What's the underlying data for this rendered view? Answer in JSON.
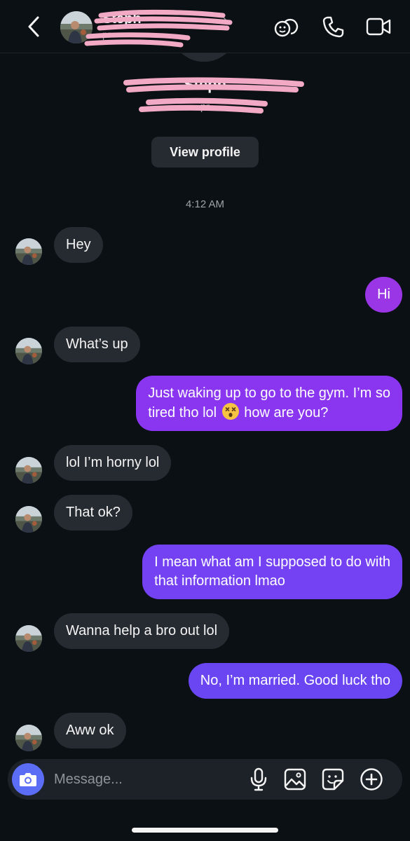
{
  "header": {
    "contact_name": "Steph",
    "contact_sub": "pr",
    "back_icon": "chevron-left-icon",
    "icons": [
      "stickers-icon",
      "phone-icon",
      "video-camera-icon"
    ]
  },
  "profile": {
    "name": "Steph",
    "handle": "pr",
    "view_profile_label": "View profile"
  },
  "thread": {
    "timestamp": "4:12 AM",
    "messages": [
      {
        "from": "them",
        "text": "Hey"
      },
      {
        "from": "me",
        "text": "Hi"
      },
      {
        "from": "them",
        "text": "What’s up"
      },
      {
        "from": "me",
        "line1": "Just waking up to go to the gym. I’m so",
        "line2_before": "tired tho lol",
        "emoji": "dizzy-face-emoji",
        "line2_after": "how are you?"
      },
      {
        "from": "them",
        "text": "lol I’m horny lol"
      },
      {
        "from": "them",
        "text": "That ok?"
      },
      {
        "from": "me",
        "line1": "I mean what am I supposed to do with",
        "line2": "that information lmao"
      },
      {
        "from": "them",
        "text": "Wanna help a bro out lol"
      },
      {
        "from": "me",
        "text": "No, I’m married. Good luck tho"
      },
      {
        "from": "them",
        "text": "Aww ok"
      }
    ]
  },
  "composer": {
    "placeholder": "Message...",
    "icons": [
      "camera-icon",
      "microphone-icon",
      "gallery-icon",
      "sticker-icon",
      "plus-icon"
    ]
  },
  "colors": {
    "background": "#0b1014",
    "incoming_bubble": "#262b31",
    "outgoing_top": "#9b36e6",
    "outgoing_bottom": "#6a46f3",
    "camera_button": "#5b6cf5",
    "redaction": "#f2a9c4"
  }
}
